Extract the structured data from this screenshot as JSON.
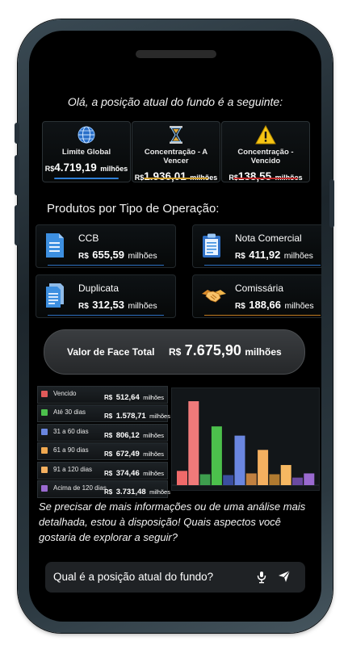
{
  "greeting": "Olá, a posição atual do fundo é a seguinte:",
  "kpis": [
    {
      "icon": "globe-icon",
      "title": "Limite Global",
      "currency": "R$",
      "value": "4.719,19",
      "unit": "milhões",
      "accent": "#2f7fd6"
    },
    {
      "icon": "hourglass-icon",
      "title": "Concentração - A Vencer",
      "currency": "R$",
      "value": "1.936,01",
      "unit": "milhões",
      "accent": "#d0a030"
    },
    {
      "icon": "warning-icon",
      "title": "Concentração - Vencido",
      "currency": "R$",
      "value": "138,55",
      "unit": "milhões",
      "accent": "#c02a2a"
    }
  ],
  "section_title": "Produtos por Tipo de Operação:",
  "products": [
    {
      "icon": "document-icon",
      "name": "CCB",
      "currency": "R$",
      "value": "655,59",
      "unit": "milhões"
    },
    {
      "icon": "clipboard-icon",
      "name": "Nota Comercial",
      "currency": "R$",
      "value": "411,92",
      "unit": "milhões"
    },
    {
      "icon": "invoice-icon",
      "name": "Duplicata",
      "currency": "R$",
      "value": "312,53",
      "unit": "milhões"
    },
    {
      "icon": "handshake-icon",
      "name": "Comissária",
      "currency": "R$",
      "value": "188,66",
      "unit": "milhões"
    }
  ],
  "total": {
    "label": "Valor de Face Total",
    "currency": "R$",
    "value": "7.675,90",
    "unit": "milhões"
  },
  "chart_data": {
    "type": "bar",
    "categories": [
      "Vencido",
      "Até 30 dias",
      "31 a 60 dias",
      "61 a 90 dias",
      "91 a 120 dias",
      "Acima de 120 dias"
    ],
    "currency": "R$",
    "unit": "milhões",
    "value_labels": [
      "512,64",
      "1.578,71",
      "806,12",
      "672,49",
      "374,46",
      "3.731,48"
    ],
    "colors": [
      "#e05a5a",
      "#4cc04c",
      "#6a86e0",
      "#f0a850",
      "#f4b060",
      "#9a6ad0"
    ],
    "bars": [
      {
        "color": "#f06a6a",
        "value": 0.17
      },
      {
        "color": "#f07a7a",
        "value": 1.0
      },
      {
        "color": "#3e9e4e",
        "value": 0.13
      },
      {
        "color": "#4cc04c",
        "value": 0.7
      },
      {
        "color": "#3b4fa0",
        "value": 0.12
      },
      {
        "color": "#6a86e0",
        "value": 0.59
      },
      {
        "color": "#c08040",
        "value": 0.14
      },
      {
        "color": "#f4b060",
        "value": 0.42
      },
      {
        "color": "#b07a30",
        "value": 0.13
      },
      {
        "color": "#f6b862",
        "value": 0.24
      },
      {
        "color": "#6a4aa0",
        "value": 0.09
      },
      {
        "color": "#9a6ad0",
        "value": 0.14
      }
    ],
    "grid": false
  },
  "closing_message": "Se precisar de mais informações ou de uma análise mais detalhada, estou à disposição! Quais aspectos você gostaria de explorar a seguir?",
  "input": {
    "value": "Qual é a posição atual do fundo?",
    "mic_icon": "microphone-icon",
    "send_icon": "send-icon"
  }
}
